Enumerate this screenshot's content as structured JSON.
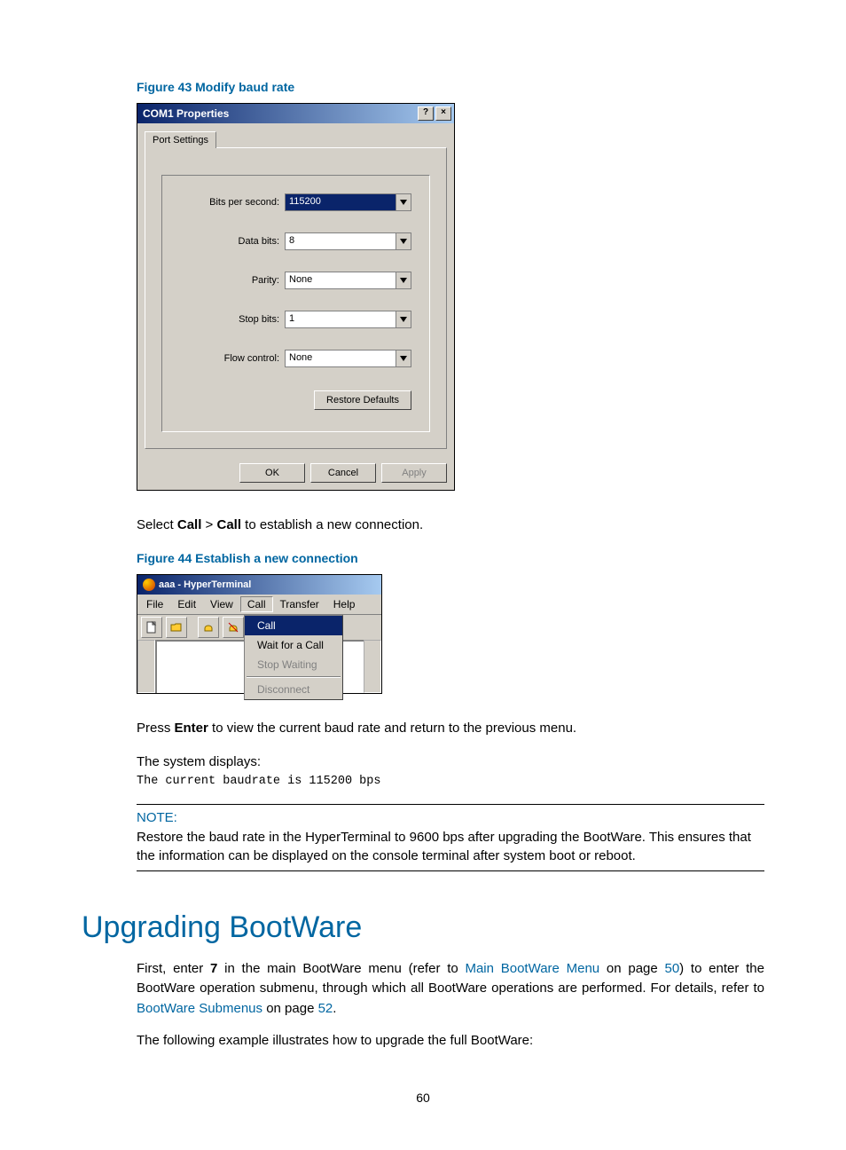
{
  "figure43": {
    "caption": "Figure 43 Modify baud rate"
  },
  "dialog": {
    "title": "COM1 Properties",
    "help": "?",
    "close": "×",
    "tab": "Port Settings",
    "fields": {
      "bits_per_second": {
        "label": "Bits per second:",
        "value": "115200"
      },
      "data_bits": {
        "label": "Data bits:",
        "value": "8"
      },
      "parity": {
        "label": "Parity:",
        "value": "None"
      },
      "stop_bits": {
        "label": "Stop bits:",
        "value": "1"
      },
      "flow_control": {
        "label": "Flow control:",
        "value": "None"
      }
    },
    "restore": "Restore Defaults",
    "ok": "OK",
    "cancel": "Cancel",
    "apply": "Apply"
  },
  "body1": {
    "pre": "Select ",
    "call1": "Call",
    "gt": " > ",
    "call2": "Call",
    "post": " to establish a new connection."
  },
  "figure44": {
    "caption": "Figure 44 Establish a new connection"
  },
  "ht": {
    "title": "aaa - HyperTerminal",
    "menu": {
      "file": "File",
      "edit": "Edit",
      "view": "View",
      "call": "Call",
      "transfer": "Transfer",
      "help": "Help"
    },
    "dropdown": {
      "call": "Call",
      "wait": "Wait for a Call",
      "stop": "Stop Waiting",
      "disconnect": "Disconnect"
    }
  },
  "body2": {
    "pre": "Press ",
    "enter": "Enter",
    "post": " to view the current baud rate and return to the previous menu."
  },
  "body3": "The system displays:",
  "code": "The current baudrate is 115200 bps",
  "note": {
    "title": "NOTE:",
    "body": "Restore the baud rate in the HyperTerminal to 9600 bps after upgrading the BootWare. This ensures that the information can be displayed on the console terminal after system boot or reboot."
  },
  "heading": "Upgrading BootWare",
  "para1": {
    "t1": "First, enter ",
    "seven": "7",
    "t2": " in the main BootWare menu (refer to ",
    "link1": "Main BootWare Menu",
    "t3": " on page ",
    "link1p": "50",
    "t4": ") to enter the BootWare operation submenu, through which all BootWare operations are performed. For details, refer to ",
    "link2": "BootWare Submenus",
    "t5": " on page ",
    "link2p": "52",
    "t6": "."
  },
  "para2": "The following example illustrates how to upgrade the full BootWare:",
  "pagenum": "60"
}
